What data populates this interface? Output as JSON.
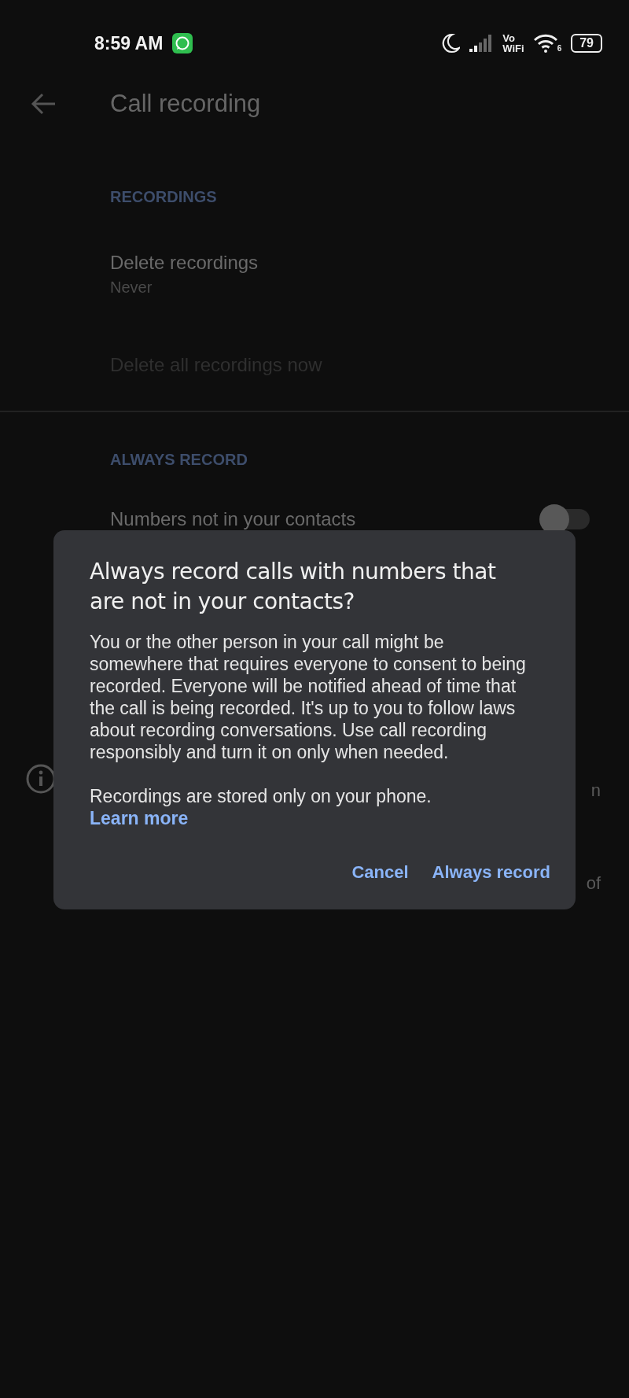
{
  "status_bar": {
    "time": "8:59 AM",
    "volte": "Vo",
    "wifi_label": "WiFi",
    "wifi_generation": "6",
    "battery": "79"
  },
  "header": {
    "title": "Call recording"
  },
  "sections": [
    {
      "heading": "RECORDINGS",
      "items": [
        {
          "kind": "setting",
          "title": "Delete recordings",
          "summary": "Never",
          "disabled": false
        },
        {
          "kind": "setting",
          "title": "Delete all recordings now",
          "disabled": true
        }
      ]
    },
    {
      "heading": "ALWAYS RECORD",
      "items": [
        {
          "kind": "switch",
          "title": "Numbers not in your contacts",
          "on": false
        }
      ]
    }
  ],
  "info_note": {
    "text_fragments": [
      "n",
      "of"
    ]
  },
  "dialog": {
    "title": "Always record calls with numbers that are not in your contacts?",
    "body": "You or the other person in your call might be somewhere that requires everyone to consent to being recorded. Everyone will be notified ahead of time that the call is being recorded. It's up to you to follow laws about recording conversations. Use call recording responsibly and turn it on only when needed.",
    "note": "Recordings are stored only on your phone.",
    "link": "Learn more",
    "buttons": [
      "Cancel",
      "Always record"
    ]
  }
}
